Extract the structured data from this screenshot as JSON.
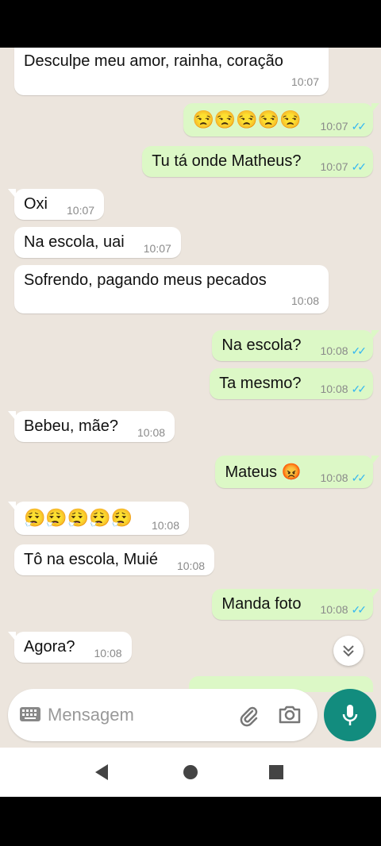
{
  "messages": [
    {
      "dir": "in",
      "text": "Desculpe meu amor, rainha, coração",
      "time": "10:07"
    },
    {
      "dir": "out",
      "text": "😒😒😒😒😒",
      "time": "10:07"
    },
    {
      "dir": "out",
      "text": "Tu tá onde Matheus?",
      "time": "10:07"
    },
    {
      "dir": "in",
      "text": "Oxi",
      "time": "10:07"
    },
    {
      "dir": "in",
      "text": "Na escola, uai",
      "time": "10:07"
    },
    {
      "dir": "in",
      "text": "Sofrendo, pagando meus pecados",
      "time": "10:08"
    },
    {
      "dir": "out",
      "text": "Na escola?",
      "time": "10:08"
    },
    {
      "dir": "out",
      "text": "Ta mesmo?",
      "time": "10:08"
    },
    {
      "dir": "in",
      "text": "Bebeu, mãe?",
      "time": "10:08"
    },
    {
      "dir": "out",
      "text": "Mateus 😡",
      "time": "10:08"
    },
    {
      "dir": "in",
      "text": "😮‍💨😮‍💨😮‍💨😮‍💨😮‍💨",
      "time": "10:08"
    },
    {
      "dir": "in",
      "text": "Tô na escola, Muié",
      "time": "10:08"
    },
    {
      "dir": "out",
      "text": "Manda foto",
      "time": "10:08"
    },
    {
      "dir": "in",
      "text": "Agora?",
      "time": "10:08"
    }
  ],
  "ticks": "✓✓",
  "input": {
    "placeholder": "Mensagem"
  },
  "icons": {
    "keyboard": "keyboard-icon",
    "attach": "paperclip-icon",
    "camera": "camera-icon",
    "mic": "mic-icon",
    "scroll": "double-chevron-down-icon",
    "back": "back-triangle-icon",
    "home": "home-circle-icon",
    "recents": "recents-square-icon"
  },
  "colors": {
    "accent": "#128c7e",
    "outgoing": "#dcf8c6",
    "incoming": "#ffffff",
    "read_ticks": "#34b7f1",
    "chat_bg": "#ece5dd"
  }
}
